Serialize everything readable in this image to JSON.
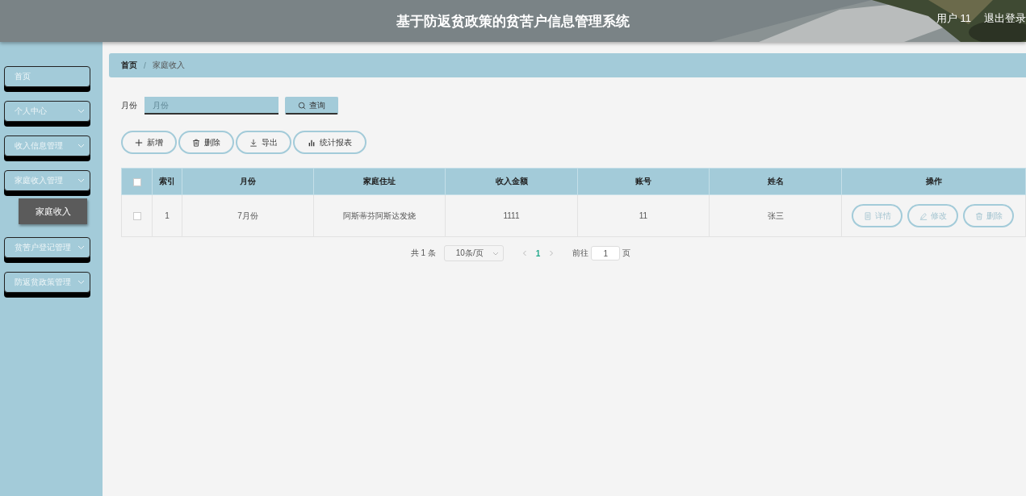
{
  "header": {
    "title": "基于防返贫政策的贫苦户信息管理系统",
    "user": "用户 11",
    "logout": "退出登录"
  },
  "sidebar": {
    "items": [
      {
        "label": "首页",
        "kind": "link"
      },
      {
        "label": "个人中心",
        "kind": "submenu"
      },
      {
        "label": "收入信息管理",
        "kind": "submenu"
      },
      {
        "label": "家庭收入管理",
        "kind": "submenu",
        "children": [
          {
            "label": "家庭收入",
            "selected": true
          }
        ]
      },
      {
        "label": "贫苦户登记管理",
        "kind": "submenu"
      },
      {
        "label": "防返贫政策管理",
        "kind": "submenu"
      }
    ]
  },
  "breadcrumb": {
    "separator": "/",
    "items": [
      {
        "label": "首页"
      },
      {
        "label": "家庭收入"
      }
    ]
  },
  "search": {
    "label": "月份",
    "placeholder": "月份",
    "button": "查询"
  },
  "toolbar": [
    {
      "label": "新增",
      "kind": "add"
    },
    {
      "label": "删除",
      "kind": "delete"
    },
    {
      "label": "导出",
      "kind": "export"
    },
    {
      "label": "统计报表",
      "kind": "chart"
    }
  ],
  "table": {
    "select_all": false,
    "columns": [
      "索引",
      "月份",
      "家庭住址",
      "收入金额",
      "账号",
      "姓名",
      "操作"
    ],
    "rows": [
      {
        "checked": false,
        "cells": [
          "1",
          "7月份",
          "阿斯蒂芬阿斯达发烧",
          "1111",
          "11",
          "张三"
        ],
        "actions": [
          {
            "label": "详情",
            "kind": "detail"
          },
          {
            "label": "修改",
            "kind": "edit"
          },
          {
            "label": "删除",
            "kind": "delete"
          }
        ]
      }
    ]
  },
  "pagination": {
    "total": "共 1 条",
    "page_size": "10条/页",
    "pages": [
      {
        "label": "1",
        "selected": true
      }
    ],
    "goto_label": "前往",
    "goto_value": "1",
    "goto_suffix": "页"
  }
}
